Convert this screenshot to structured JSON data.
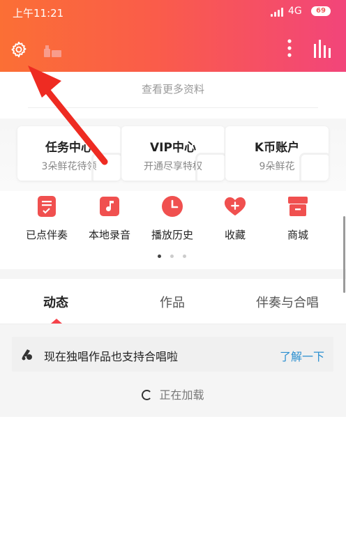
{
  "status_bar": {
    "time": "上午11:21",
    "network": "4G",
    "battery": "69"
  },
  "link": {
    "view_more": "查看更多资料"
  },
  "cards": [
    {
      "title": "任务中心",
      "subtitle": "3朵鲜花待领"
    },
    {
      "title": "VIP中心",
      "subtitle": "开通尽享特权"
    },
    {
      "title": "K币账户",
      "subtitle": "9朵鲜花"
    }
  ],
  "features": [
    {
      "label": "已点伴奏",
      "icon": "checklist-icon"
    },
    {
      "label": "本地录音",
      "icon": "music-note-icon"
    },
    {
      "label": "播放历史",
      "icon": "clock-icon"
    },
    {
      "label": "收藏",
      "icon": "heart-plus-icon"
    },
    {
      "label": "商城",
      "icon": "shop-box-icon"
    }
  ],
  "pager": {
    "pages": 3,
    "current": 1
  },
  "tabs": [
    {
      "label": "动态",
      "active": true
    },
    {
      "label": "作品",
      "active": false
    },
    {
      "label": "伴奏与合唱",
      "active": false
    }
  ],
  "notice": {
    "text": "现在独唱作品也支持合唱啦",
    "link": "了解一下"
  },
  "loading": {
    "text": "正在加载"
  },
  "colors": {
    "accent": "#f5424a",
    "header_start": "#fb6f35",
    "header_end": "#f2457a",
    "link": "#2b8fd0"
  }
}
